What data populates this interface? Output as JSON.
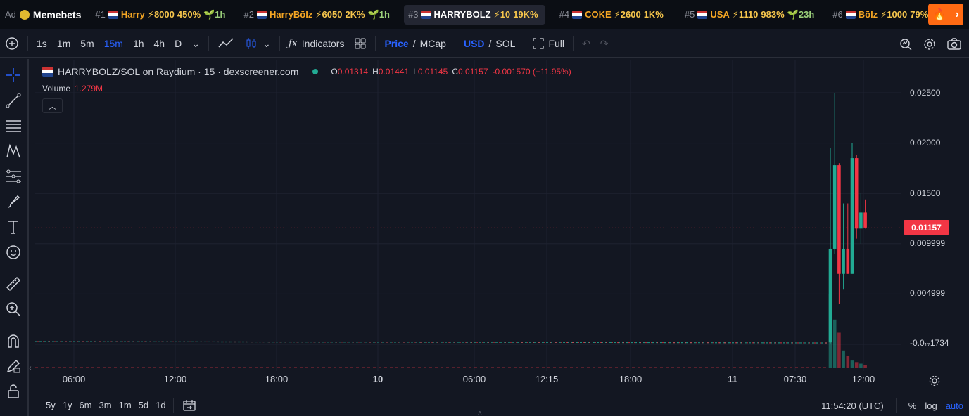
{
  "ticker": {
    "ad_label": "Ad",
    "brand": "Memebets",
    "items": [
      {
        "rank": "#1",
        "name": "Harry",
        "bolt": "⚡8000",
        "pct": "450%",
        "age": "🌱1h",
        "color": "#f5a623"
      },
      {
        "rank": "#2",
        "name": "HarryBōlz",
        "bolt": "⚡6050",
        "pct": "2K%",
        "age": "🌱1h",
        "color": "#f5a623"
      },
      {
        "rank": "#3",
        "name": "HARRYBOLZ",
        "bolt": "⚡10",
        "pct": "19K%",
        "age": "",
        "color": "#ffffff"
      },
      {
        "rank": "#4",
        "name": "COKE",
        "bolt": "⚡2600",
        "pct": "1K%",
        "age": "",
        "color": "#f5a623"
      },
      {
        "rank": "#5",
        "name": "USA",
        "bolt": "⚡1110",
        "pct": "983%",
        "age": "🌱23h",
        "color": "#f5a623"
      },
      {
        "rank": "#6",
        "name": "Bōlz",
        "bolt": "⚡1000",
        "pct": "79%",
        "age": "",
        "color": "#f5a623"
      }
    ]
  },
  "toolbar": {
    "intervals": [
      "1s",
      "1m",
      "5m",
      "15m",
      "1h",
      "4h",
      "D"
    ],
    "active_interval": "15m",
    "indicators_label": "Indicators",
    "price_label": "Price",
    "mcap_label": "MCap",
    "usd_label": "USD",
    "sol_label": "SOL",
    "full_label": "Full",
    "slash": "/"
  },
  "legend": {
    "title": "HARRYBOLZ/SOL on Raydium · 15 · dexscreener.com",
    "o_label": "O",
    "o_val": "0.01314",
    "h_label": "H",
    "h_val": "0.01441",
    "l_label": "L",
    "l_val": "0.01145",
    "c_label": "C",
    "c_val": "0.01157",
    "change": "-0.001570 (−11.95%)",
    "volume_label": "Volume",
    "volume_val": "1.279M"
  },
  "y_axis": {
    "labels": [
      "0.02500",
      "0.02000",
      "0.01500",
      "0.009999",
      "0.004999",
      "-0.0₁₇1734"
    ],
    "last_price": "0.01157"
  },
  "x_axis": {
    "labels": [
      "06:00",
      "12:00",
      "18:00",
      "10",
      "06:00",
      "12:15",
      "18:00",
      "11",
      "07:30",
      "12:00"
    ]
  },
  "bottom": {
    "ranges": [
      "5y",
      "1y",
      "6m",
      "3m",
      "1m",
      "5d",
      "1d"
    ],
    "clock": "11:54:20 (UTC)",
    "pct": "%",
    "log": "log",
    "auto": "auto"
  },
  "colors": {
    "up": "#22ab94",
    "down": "#f23645",
    "accent": "#2962ff",
    "background": "#131722"
  },
  "chart_data": {
    "type": "candlestick",
    "candles": [
      {
        "o": 0.0002,
        "h": 0.0195,
        "l": 0.0001,
        "c": 0.0095
      },
      {
        "o": 0.0095,
        "h": 0.025,
        "l": 0.009,
        "c": 0.0178
      },
      {
        "o": 0.0178,
        "h": 0.018,
        "l": 0.004,
        "c": 0.007
      },
      {
        "o": 0.007,
        "h": 0.014,
        "l": 0.0055,
        "c": 0.0095
      },
      {
        "o": 0.0095,
        "h": 0.014,
        "l": 0.007,
        "c": 0.007
      },
      {
        "o": 0.007,
        "h": 0.02,
        "l": 0.007,
        "c": 0.0185
      },
      {
        "o": 0.0185,
        "h": 0.0188,
        "l": 0.0105,
        "c": 0.0115
      },
      {
        "o": 0.0115,
        "h": 0.015,
        "l": 0.01,
        "c": 0.0131
      },
      {
        "o": 0.0131,
        "h": 0.0144,
        "l": 0.0115,
        "c": 0.0116
      }
    ],
    "volumes": [
      0.95,
      0.62,
      0.45,
      0.22,
      0.15,
      0.09,
      0.07,
      0.05,
      0.03
    ],
    "y_range": [
      -0.0025,
      0.0255
    ]
  }
}
